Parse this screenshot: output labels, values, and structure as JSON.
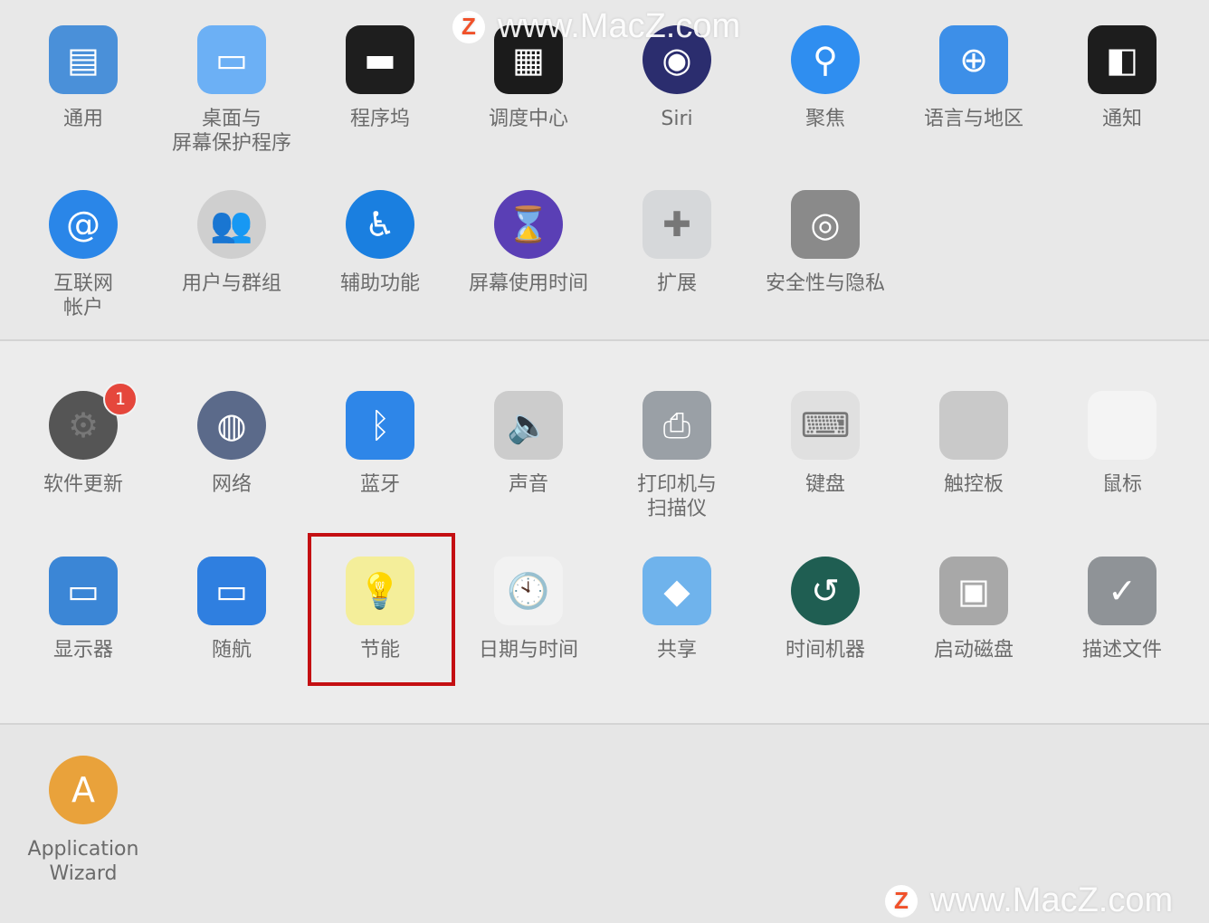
{
  "sections": [
    {
      "items": [
        {
          "label": "通用",
          "icon": "general-icon",
          "color": "#4a90d9",
          "glyph": "▤"
        },
        {
          "label": "桌面与\n屏幕保护程序",
          "icon": "desktop-screensaver-icon",
          "color": "#6cb0f5",
          "glyph": "▭"
        },
        {
          "label": "程序坞",
          "icon": "dock-icon",
          "color": "#1e1e1e",
          "glyph": "▬"
        },
        {
          "label": "调度中心",
          "icon": "mission-control-icon",
          "color": "#1b1b1b",
          "glyph": "▦"
        },
        {
          "label": "Siri",
          "icon": "siri-icon",
          "color": "#2b2d6e",
          "glyph": "◉"
        },
        {
          "label": "聚焦",
          "icon": "spotlight-icon",
          "color": "#2f8ef0",
          "glyph": "⚲"
        },
        {
          "label": "语言与地区",
          "icon": "language-region-icon",
          "color": "#3d8fe8",
          "glyph": "⊕"
        },
        {
          "label": "通知",
          "icon": "notifications-icon",
          "color": "#1d1d1d",
          "glyph": "◧"
        },
        {
          "label": "互联网\n帐户",
          "icon": "internet-accounts-icon",
          "color": "#2a86e8",
          "glyph": "@"
        },
        {
          "label": "用户与群组",
          "icon": "users-groups-icon",
          "color": "#cfcfcf",
          "glyph": "👥"
        },
        {
          "label": "辅助功能",
          "icon": "accessibility-icon",
          "color": "#1a7fe0",
          "glyph": "♿"
        },
        {
          "label": "屏幕使用时间",
          "icon": "screen-time-icon",
          "color": "#5a3fb5",
          "glyph": "⌛"
        },
        {
          "label": "扩展",
          "icon": "extensions-icon",
          "color": "#d6d8da",
          "glyph": "✚"
        },
        {
          "label": "安全性与隐私",
          "icon": "security-privacy-icon",
          "color": "#8a8a8a",
          "glyph": "◎"
        }
      ]
    },
    {
      "items": [
        {
          "label": "软件更新",
          "icon": "software-update-icon",
          "color": "#555555",
          "glyph": "⚙",
          "badge": "1"
        },
        {
          "label": "网络",
          "icon": "network-icon",
          "color": "#5b6a8a",
          "glyph": "◍"
        },
        {
          "label": "蓝牙",
          "icon": "bluetooth-icon",
          "color": "#2e86e8",
          "glyph": "ᛒ"
        },
        {
          "label": "声音",
          "icon": "sound-icon",
          "color": "#cccccc",
          "glyph": "🔈"
        },
        {
          "label": "打印机与\n扫描仪",
          "icon": "printers-scanners-icon",
          "color": "#9aa0a6",
          "glyph": "⎙"
        },
        {
          "label": "键盘",
          "icon": "keyboard-icon",
          "color": "#e0e0e0",
          "glyph": "⌨"
        },
        {
          "label": "触控板",
          "icon": "trackpad-icon",
          "color": "#c9c9c9",
          "glyph": ""
        },
        {
          "label": "鼠标",
          "icon": "mouse-icon",
          "color": "#f4f4f4",
          "glyph": ""
        },
        {
          "label": "显示器",
          "icon": "displays-icon",
          "color": "#3b86d6",
          "glyph": "▭"
        },
        {
          "label": "随航",
          "icon": "sidecar-icon",
          "color": "#2f7fe0",
          "glyph": "▭"
        },
        {
          "label": "节能",
          "icon": "energy-saver-icon",
          "color": "#f4ee9a",
          "glyph": "💡"
        },
        {
          "label": "日期与时间",
          "icon": "date-time-icon",
          "color": "#f2f2f2",
          "glyph": "🕙"
        },
        {
          "label": "共享",
          "icon": "sharing-icon",
          "color": "#6fb3ec",
          "glyph": "◆"
        },
        {
          "label": "时间机器",
          "icon": "time-machine-icon",
          "color": "#1f5e52",
          "glyph": "↺"
        },
        {
          "label": "启动磁盘",
          "icon": "startup-disk-icon",
          "color": "#a8a8a8",
          "glyph": "▣"
        },
        {
          "label": "描述文件",
          "icon": "profiles-icon",
          "color": "#8f9397",
          "glyph": "✓"
        }
      ]
    },
    {
      "items": [
        {
          "label": "Application\nWizard",
          "icon": "application-wizard-icon",
          "color": "#e9a23b",
          "glyph": "A"
        }
      ]
    }
  ],
  "highlighted_item": "节能",
  "highlight_color": "#c40f12",
  "watermark": {
    "logo": "Z",
    "text": "www.MacZ.com"
  }
}
